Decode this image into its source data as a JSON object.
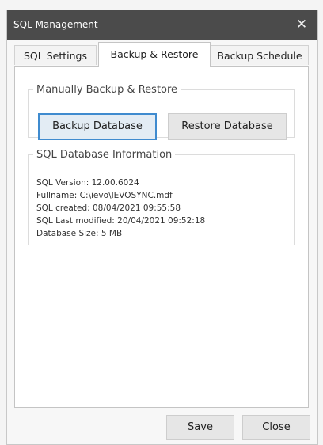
{
  "window": {
    "title": "SQL Management",
    "close_glyph": "✕"
  },
  "tabs": [
    {
      "label": "SQL Settings",
      "active": false
    },
    {
      "label": "Backup & Restore",
      "active": true
    },
    {
      "label": "Backup Schedule",
      "active": false
    }
  ],
  "manual": {
    "legend": "Manually Backup & Restore",
    "backup_label": "Backup Database",
    "restore_label": "Restore Database"
  },
  "info": {
    "legend": "SQL Database Information",
    "lines": [
      "SQL Version: 12.00.6024",
      "Fullname: C:\\ievo\\IEVOSYNC.mdf",
      "SQL created: 08/04/2021 09:55:58",
      "SQL Last modified: 20/04/2021 09:52:18",
      "Database Size: 5 MB"
    ]
  },
  "footer": {
    "save_label": "Save",
    "close_label": "Close"
  },
  "colors": {
    "titlebar": "#4b4b4b",
    "focus_border": "#3f8bcf"
  }
}
